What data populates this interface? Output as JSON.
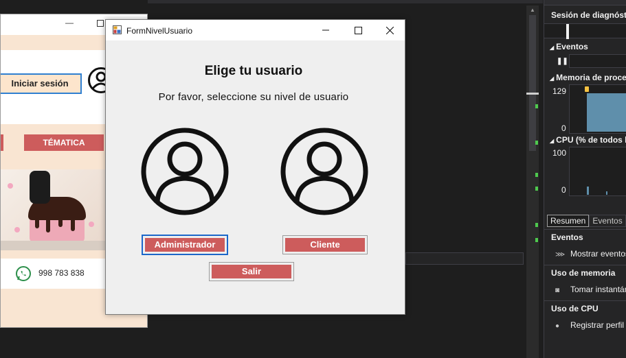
{
  "diagnostics": {
    "title": "Sesión de diagnóstic",
    "events_section": "Eventos",
    "memory_section": "Memoria de proces",
    "memory_axis": [
      "129",
      "0"
    ],
    "cpu_section": "CPU (% de todos lo",
    "cpu_axis": [
      "100",
      "0"
    ],
    "tabs": [
      "Resumen",
      "Eventos"
    ],
    "events_header": "Eventos",
    "show_events": "Mostrar eventos",
    "memory_header": "Uso de memoria",
    "take_snapshot": "Tomar instantán",
    "cpu_header": "Uso de CPU",
    "record_profile": "Registrar perfil C"
  },
  "background_form": {
    "login_button": "Iniciar sesión",
    "menu_item": "TÉMATICA",
    "phone": "998 783 838"
  },
  "dialog": {
    "window_title": "FormNivelUsuario",
    "heading": "Elige tu usuario",
    "subtitle": "Por favor, seleccione su nivel de usuario",
    "admin_button": "Administrador",
    "client_button": "Cliente",
    "exit_button": "Salir"
  },
  "colors": {
    "button_red": "#cd5c5c",
    "focus_blue": "#1b66c9",
    "peach": "#f9e5d2"
  }
}
